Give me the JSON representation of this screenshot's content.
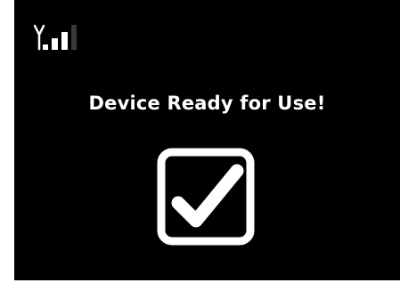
{
  "status_bar": {
    "signal_icon": "antenna-signal-icon",
    "signal_bars_lit": 3,
    "signal_bars_total": 4
  },
  "main": {
    "message": "Device Ready for Use!",
    "status_icon": "checkmark-box-icon"
  },
  "colors": {
    "background": "#000000",
    "foreground": "#ffffff",
    "dim_bar": "#3a3a3a"
  }
}
